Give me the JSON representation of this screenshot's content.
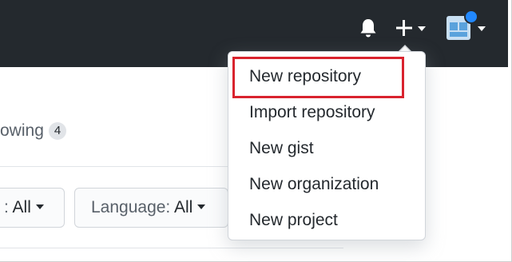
{
  "header": {
    "bell_icon": "bell-icon",
    "plus_icon": "plus-icon",
    "avatar_icon": "avatar",
    "notification_color": "#2188ff",
    "background_color": "#24292e"
  },
  "profile": {
    "following_text": "owing",
    "following_count": "4"
  },
  "filters": {
    "type": {
      "label": ":",
      "value": "All"
    },
    "language": {
      "label": "Language:",
      "value": "All"
    }
  },
  "create_menu": {
    "items": [
      {
        "label": "New repository"
      },
      {
        "label": "Import repository"
      },
      {
        "label": "New gist"
      },
      {
        "label": "New organization"
      },
      {
        "label": "New project"
      }
    ],
    "highlight_color": "#d9232e"
  }
}
